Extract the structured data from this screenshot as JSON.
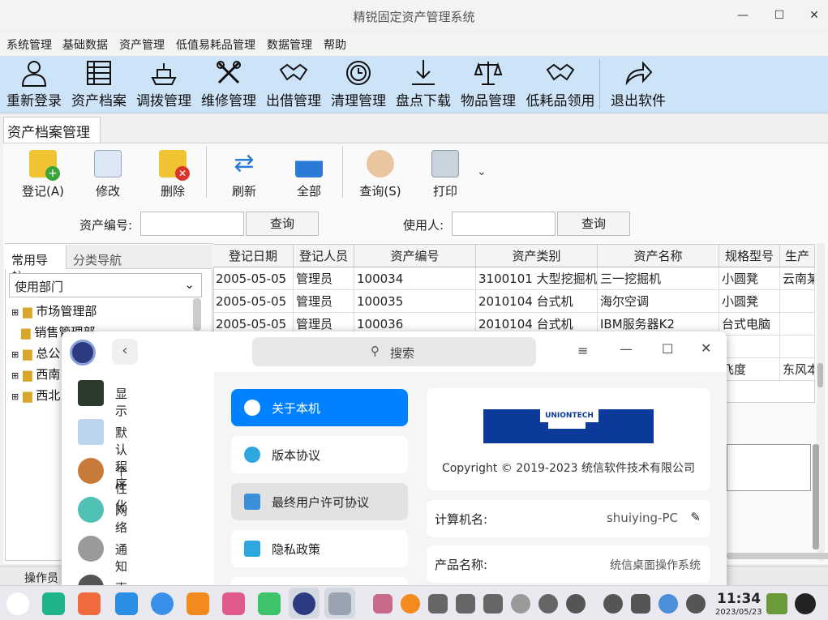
{
  "window": {
    "title": "精锐固定资产管理系统",
    "min": "—",
    "max": "☐",
    "close": "✕"
  },
  "menu": [
    "系统管理",
    "基础数据",
    "资产管理",
    "低值易耗品管理",
    "数据管理",
    "帮助"
  ],
  "toolbar": [
    "重新登录",
    "资产档案",
    "调拨管理",
    "维修管理",
    "出借管理",
    "清理管理",
    "盘点下载",
    "物品管理",
    "低耗品领用",
    "退出软件"
  ],
  "tab": "资产档案管理",
  "actions": [
    "登记(A)",
    "修改",
    "删除",
    "刷新",
    "全部",
    "查询(S)",
    "打印"
  ],
  "search": {
    "asset_no_label": "资产编号:",
    "query1": "查询",
    "user_label": "使用人:",
    "query2": "查询"
  },
  "nav": {
    "tab1": "常用导航",
    "tab2": "分类导航",
    "select": "使用部门",
    "tree": [
      "市场管理部",
      "销售管理部",
      "总公",
      "西南",
      "西北"
    ]
  },
  "grid": {
    "headers": [
      "登记日期",
      "登记人员",
      "资产编号",
      "资产类别",
      "资产名称",
      "规格型号",
      "生产厂"
    ],
    "rows": [
      [
        "2005-05-05",
        "管理员",
        "100034",
        "3100101 大型挖掘机",
        "三一挖掘机",
        "小圆凳",
        "云南某"
      ],
      [
        "2005-05-05",
        "管理员",
        "100035",
        "2010104 台式机",
        "海尔空调",
        "小圆凳",
        ""
      ],
      [
        "2005-05-05",
        "管理员",
        "100036",
        "2010104 台式机",
        "IBM服务器K2",
        "台式电脑",
        ""
      ]
    ],
    "extra": {
      "c6": "飞度",
      "c7": "东风本"
    }
  },
  "status": "操作员",
  "dialog": {
    "search": "搜索",
    "side": [
      "显示",
      "默认程序",
      "个性化",
      "网络",
      "通知",
      "声音"
    ],
    "mid": [
      "关于本机",
      "版本协议",
      "最终用户许可协议",
      "隐私政策"
    ],
    "brand": "UNIONTECH",
    "copyright": "Copyright © 2019-2023 统信软件技术有限公司",
    "computer_label": "计算机名:",
    "computer_value": "shuiying-PC",
    "product_label": "产品名称:",
    "product_value": "统信桌面操作系统"
  },
  "taskbar": {
    "time": "11:34",
    "date": "2023/05/23"
  }
}
